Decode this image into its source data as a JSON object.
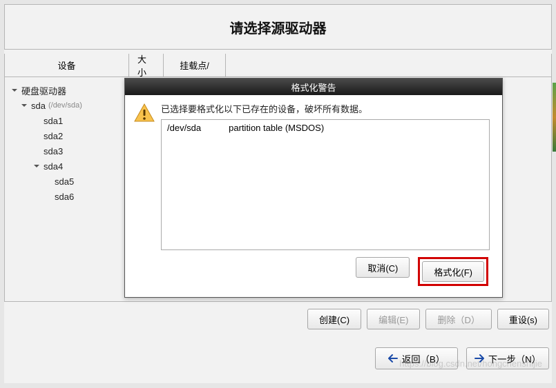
{
  "main": {
    "title": "请选择源驱动器",
    "columns": {
      "device": "设备",
      "size": "大小",
      "mount": "挂载点/"
    },
    "tree": {
      "root": "硬盘驱动器",
      "sda": {
        "label": "sda",
        "sub": "(/dev/sda)"
      },
      "p1": "sda1",
      "p2": "sda2",
      "p3": "sda3",
      "p4": "sda4",
      "p5": "sda5",
      "p6": "sda6"
    }
  },
  "bottom": {
    "create": "创建(C)",
    "edit": "编辑(E)",
    "delete": "删除（D）",
    "reset": "重设(s)"
  },
  "nav": {
    "back": "返回（B）",
    "next": "下一步（N）"
  },
  "dialog": {
    "title": "格式化警告",
    "message": "已选择要格式化以下已存在的设备，破坏所有数据。",
    "device_path": "/dev/sda",
    "device_desc": "partition table (MSDOS)",
    "cancel": "取消(C)",
    "format": "格式化(F)"
  },
  "watermark": "https://blog.csdn.net/hongchenshijie"
}
